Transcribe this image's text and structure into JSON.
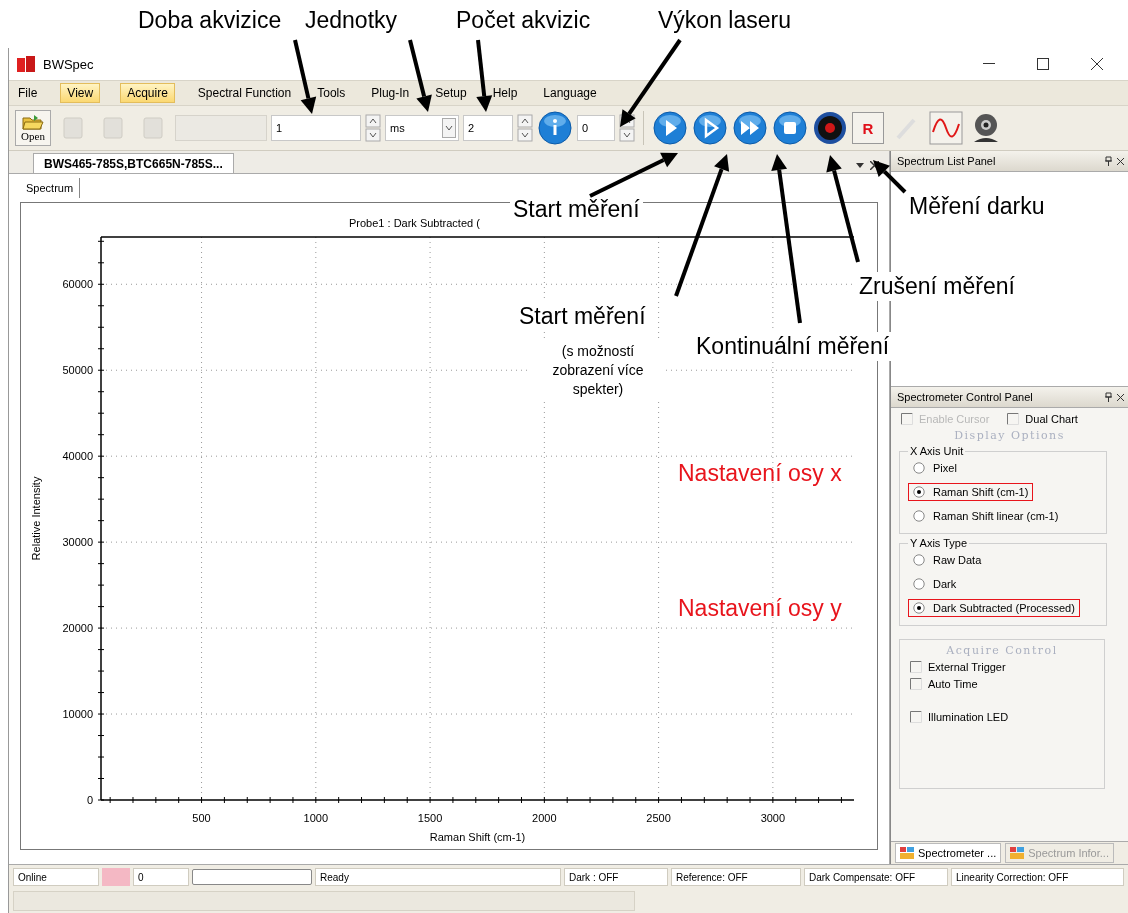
{
  "annotations": [
    {
      "kind": "label",
      "text": "Doba akvizice"
    },
    {
      "kind": "label",
      "text": "Jednotky"
    },
    {
      "kind": "label",
      "text": "Počet  akvizic"
    },
    {
      "kind": "label",
      "text": "Výkon laseru"
    },
    {
      "kind": "label",
      "text": "Start měření"
    },
    {
      "kind": "label",
      "text": "Start měření"
    },
    {
      "kind": "note",
      "text": "(s možností zobrazení více spekter)"
    },
    {
      "kind": "label",
      "text": "Kontinuální měření"
    },
    {
      "kind": "label",
      "text": "Zrušení měření"
    },
    {
      "kind": "label",
      "text": "Měření darku"
    },
    {
      "kind": "red",
      "text": "Nastavení osy x"
    },
    {
      "kind": "red",
      "text": "Nastavení osy y"
    }
  ],
  "window": {
    "title": "BWSpec"
  },
  "menu": [
    {
      "label": "File",
      "highlighted": false
    },
    {
      "label": "View",
      "highlighted": true
    },
    {
      "label": "Acquire",
      "highlighted": true
    },
    {
      "label": "Spectral Function",
      "highlighted": false
    },
    {
      "label": "Tools",
      "highlighted": false
    },
    {
      "label": "Plug-In",
      "highlighted": false
    },
    {
      "label": "Setup",
      "highlighted": false
    },
    {
      "label": "Help",
      "highlighted": false
    },
    {
      "label": "Language",
      "highlighted": false
    }
  ],
  "toolbar": {
    "open_button": {
      "label": "Open"
    },
    "integration_time": {
      "value": "1"
    },
    "unit_select": {
      "value": "ms"
    },
    "average_count": {
      "value": "2"
    },
    "laser_power": {
      "value": "0"
    },
    "reference_button": {
      "label": "R"
    }
  },
  "document_tabs": [
    {
      "label": "BWS465-785S,BTC665N-785S...",
      "selected": true
    }
  ],
  "view_tabs": [
    {
      "label": "Spectrum",
      "selected": true
    }
  ],
  "chart": {
    "chart_data": {
      "type": "line",
      "title": "Probe1 : Dark Subtracted (",
      "xlabel": "Raman Shift (cm-1)",
      "ylabel": "Relative Intensity",
      "grid": true,
      "xlim": [
        60,
        3355
      ],
      "ylim": [
        0,
        65500
      ],
      "xticks": [
        500,
        1000,
        1500,
        2000,
        2500,
        3000
      ],
      "yticks": [
        0,
        10000,
        20000,
        30000,
        40000,
        50000,
        60000
      ]
    }
  },
  "spectrum_list_panel": {
    "title": "Spectrum List Panel"
  },
  "control_panel": {
    "title": "Spectrometer Control Panel",
    "options": [
      {
        "label": "Enable Cursor",
        "checked": false,
        "disabled": true
      },
      {
        "label": "Dual Chart",
        "checked": false,
        "disabled": false
      }
    ],
    "display_heading": "Display Options",
    "x_axis": {
      "title": "X Axis Unit",
      "options": [
        {
          "label": "Pixel",
          "selected": false,
          "highlighted": false
        },
        {
          "label": "Raman Shift (cm-1)",
          "selected": true,
          "highlighted": true
        },
        {
          "label": "Raman Shift linear (cm-1)",
          "selected": false,
          "highlighted": false
        }
      ]
    },
    "y_axis": {
      "title": "Y Axis Type",
      "options": [
        {
          "label": "Raw Data",
          "selected": false,
          "highlighted": false
        },
        {
          "label": "Dark",
          "selected": false,
          "highlighted": false
        },
        {
          "label": "Dark Subtracted (Processed)",
          "selected": true,
          "highlighted": true
        }
      ]
    },
    "acquire_control": {
      "title": "Acquire Control",
      "options": [
        {
          "label": "External Trigger",
          "checked": false
        },
        {
          "label": "Auto Time",
          "checked": false
        },
        {
          "label": "Illumination LED",
          "checked": false
        }
      ]
    }
  },
  "panel_tabs": [
    {
      "label": "Spectrometer ...",
      "selected": true
    },
    {
      "label": "Spectrum Infor...",
      "selected": false
    }
  ],
  "status_bar": [
    {
      "kind": "text",
      "text": "Online"
    },
    {
      "kind": "swatch"
    },
    {
      "kind": "text",
      "text": "0"
    },
    {
      "kind": "progress",
      "level": 0
    },
    {
      "kind": "text",
      "text": "Ready"
    },
    {
      "kind": "text",
      "text": "Dark : OFF"
    },
    {
      "kind": "text",
      "text": "Reference: OFF"
    },
    {
      "kind": "text",
      "text": "Dark Compensate: OFF"
    },
    {
      "kind": "text",
      "text": "Linearity Correction: OFF"
    }
  ]
}
